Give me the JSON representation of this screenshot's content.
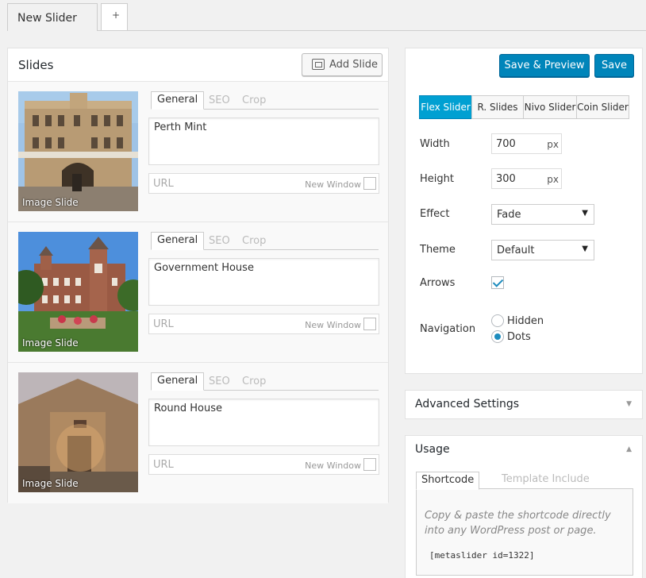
{
  "tabs": {
    "current": "New Slider",
    "add": "+"
  },
  "slides_panel": {
    "title": "Slides",
    "add_button": "Add Slide",
    "slides": [
      {
        "thumb_label": "Image Slide",
        "tab_general": "General",
        "tab_seo": "SEO",
        "tab_crop": "Crop",
        "caption": "Perth Mint",
        "url_placeholder": "URL",
        "new_window": "New Window"
      },
      {
        "thumb_label": "Image Slide",
        "tab_general": "General",
        "tab_seo": "SEO",
        "tab_crop": "Crop",
        "caption": "Government House",
        "url_placeholder": "URL",
        "new_window": "New Window"
      },
      {
        "thumb_label": "Image Slide",
        "tab_general": "General",
        "tab_seo": "SEO",
        "tab_crop": "Crop",
        "caption": "Round House",
        "url_placeholder": "URL",
        "new_window": "New Window"
      }
    ]
  },
  "settings": {
    "save_preview": "Save & Preview",
    "save": "Save",
    "slider_types": [
      "Flex Slider",
      "R. Slides",
      "Nivo Slider",
      "Coin Slider"
    ],
    "active_type": "Flex Slider",
    "width_label": "Width",
    "width_value": "700",
    "width_unit": "px",
    "height_label": "Height",
    "height_value": "300",
    "height_unit": "px",
    "effect_label": "Effect",
    "effect_value": "Fade",
    "theme_label": "Theme",
    "theme_value": "Default",
    "arrows_label": "Arrows",
    "arrows_checked": true,
    "navigation_label": "Navigation",
    "nav_hidden": "Hidden",
    "nav_dots": "Dots",
    "nav_selected": "Dots"
  },
  "advanced": {
    "title": "Advanced Settings"
  },
  "usage": {
    "title": "Usage",
    "tab_shortcode": "Shortcode",
    "tab_template": "Template Include",
    "description": "Copy & paste the shortcode directly into any WordPress post or page.",
    "code": "[metaslider id=1322]"
  },
  "colors": {
    "primary": "#0085ba",
    "active_tab": "#00a0d2",
    "background": "#f1f1f1"
  }
}
